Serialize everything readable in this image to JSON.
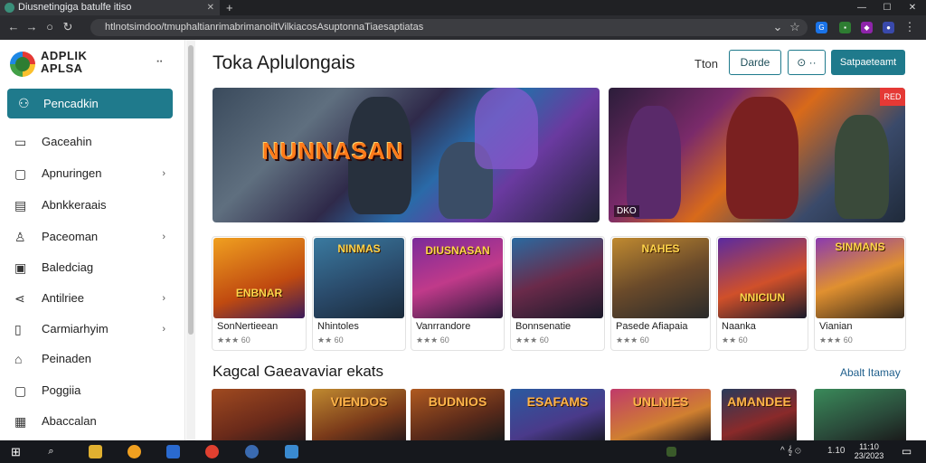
{
  "browser": {
    "tab_title": "Diusnetingiga batulfe itiso",
    "new_tab": "+",
    "url": "htlnotsimdoo/tmuphaltianrimabrimanoiltVilkiacosAsuptonnaTiaesaptiatas",
    "window_controls": [
      "—",
      "☐",
      "✕"
    ],
    "extensions": [
      {
        "name": "google-ext-icon",
        "color": "#1a73e8",
        "glyph": "G"
      },
      {
        "name": "shield-ext-icon",
        "color": "#8e24aa",
        "glyph": "◆"
      },
      {
        "name": "profile-ext-icon",
        "color": "#3949ab",
        "glyph": "●"
      }
    ]
  },
  "sidebar": {
    "brand": "ADPLIK\nAPLSA",
    "menu_icon": "⠒",
    "active_item": {
      "label": "Pencadkin",
      "icon": "users-icon"
    },
    "items": [
      {
        "label": "Gaceahin",
        "chevron": false
      },
      {
        "label": "Apnuringen",
        "chevron": true
      },
      {
        "label": "Abnkkeraais",
        "chevron": false
      },
      {
        "label": "Paceoman",
        "chevron": true
      },
      {
        "label": "Baledciag",
        "chevron": false
      },
      {
        "label": "Antilriee",
        "chevron": true
      },
      {
        "label": "Carmiarhyim",
        "chevron": true
      },
      {
        "label": "Peinaden",
        "chevron": false
      },
      {
        "label": "Poggiia",
        "chevron": false
      },
      {
        "label": "Abaccalan",
        "chevron": false
      }
    ]
  },
  "header": {
    "title": "Toka Aplulongais",
    "link": "Tton",
    "outline_button": "Darde",
    "icon_button": "⊙ ··",
    "primary_button": "Satpaeteamt"
  },
  "banners": [
    {
      "title": "NUNNASAN",
      "badge": "",
      "tag": ""
    },
    {
      "title": "",
      "badge": "RED",
      "tag": "DKO"
    }
  ],
  "apps": [
    {
      "name": "SonNertieean",
      "rating": "★★★ 60",
      "thumb_label": "ENBNAR"
    },
    {
      "name": "Nhintoles",
      "rating": "★★ 60",
      "thumb_label": "NINMAS"
    },
    {
      "name": "Vanrrandore",
      "rating": "★★★ 60",
      "thumb_label": "DIUSNASAN"
    },
    {
      "name": "Bonnsenatie",
      "rating": "★★★ 60",
      "thumb_label": ""
    },
    {
      "name": "Pasede Afiapaia",
      "rating": "★★★ 60",
      "thumb_label": "NAHES"
    },
    {
      "name": "Naanka",
      "rating": "★★ 60",
      "thumb_label": "NNICIUN"
    },
    {
      "name": "Vianian",
      "rating": "★★★ 60",
      "thumb_label": "SINMANS"
    }
  ],
  "section": {
    "title": "Kagcal Gaeavaviar ekats",
    "link": "Abalt Itamay",
    "thumbs": [
      "",
      "VIENDOS",
      "BUDNIOS",
      "ESAFAMS",
      "UNLNIES",
      "AMANDEE",
      ""
    ]
  },
  "taskbar": {
    "clock_time": "11:10",
    "clock_date": "23/2023",
    "tray": "^ 𝄞 ⊙"
  }
}
